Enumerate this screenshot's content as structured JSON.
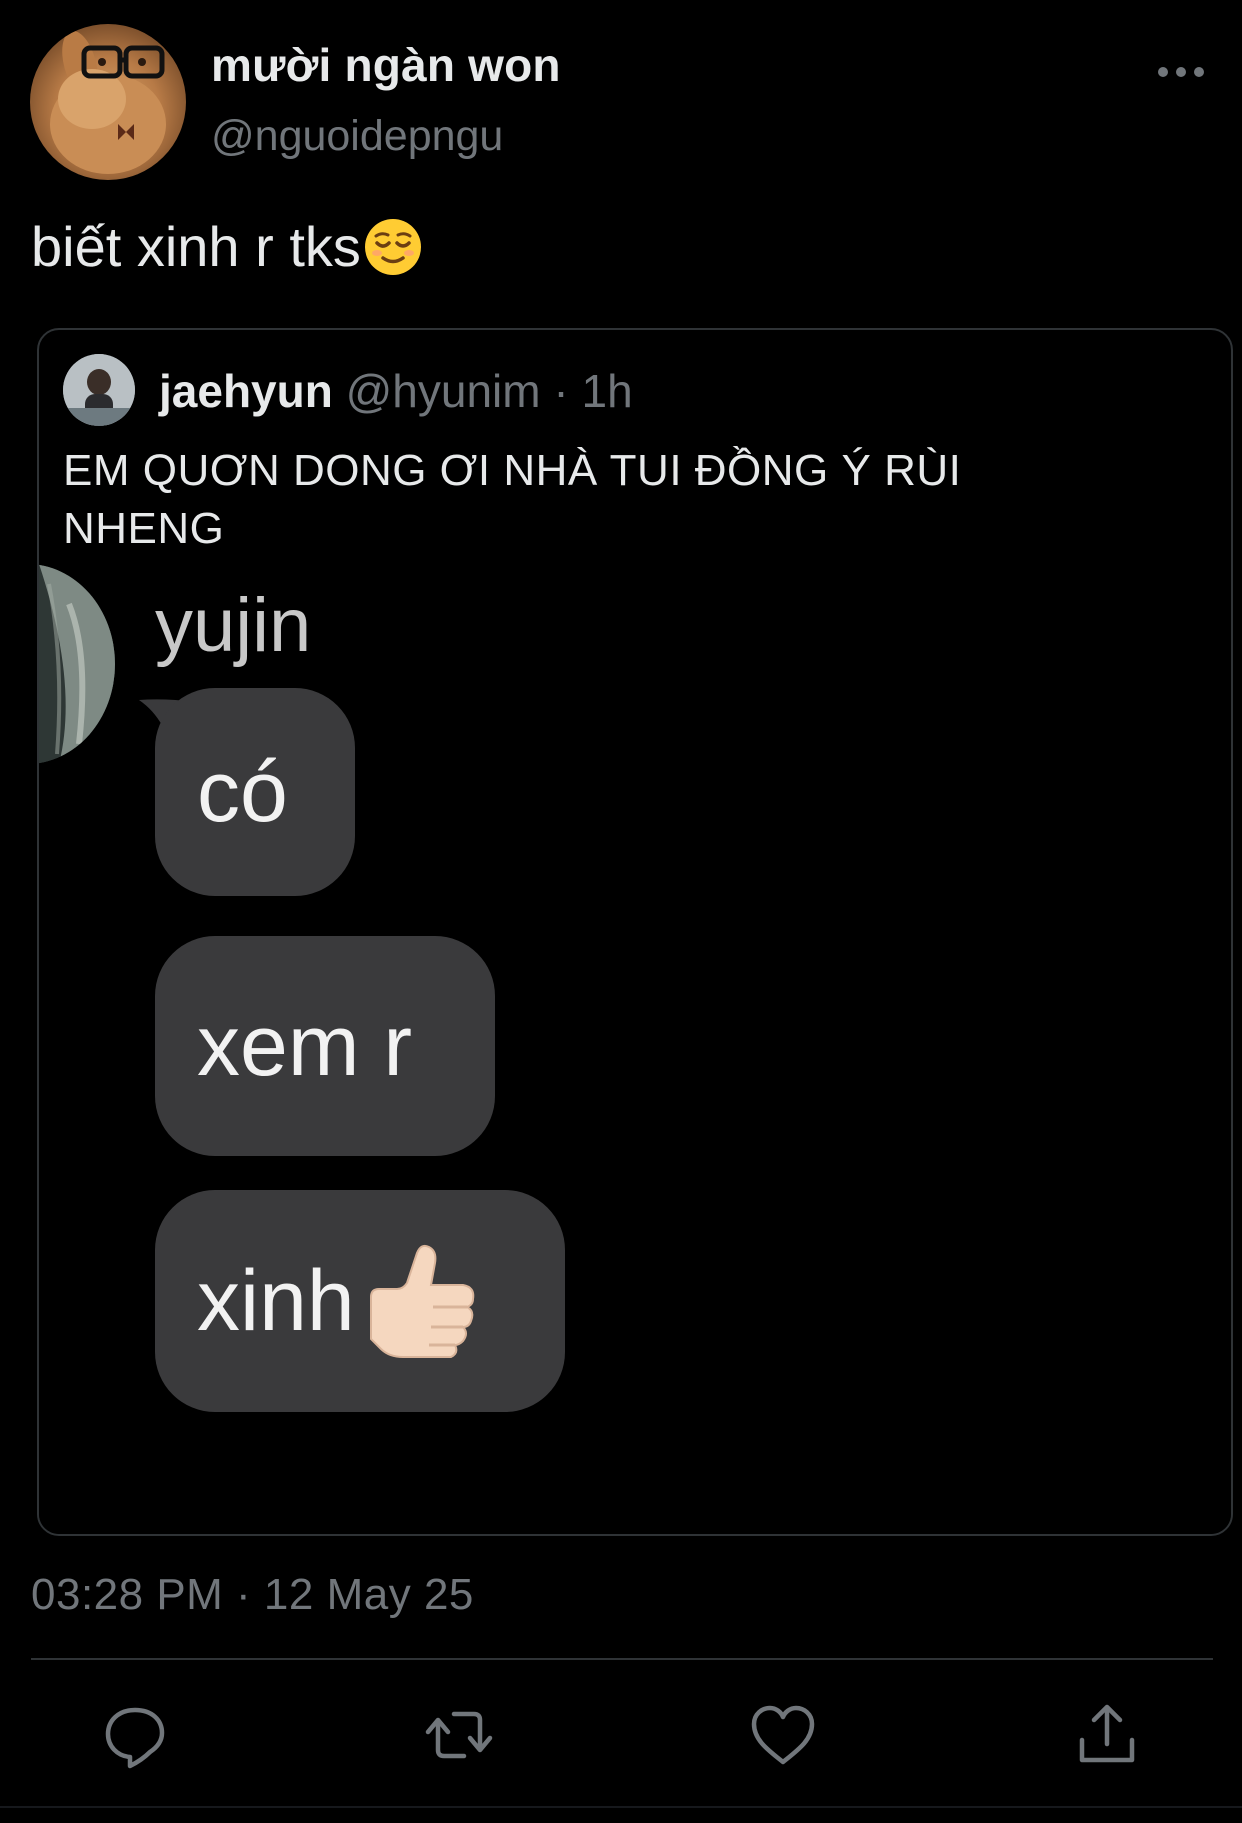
{
  "tweet": {
    "display_name": "mười ngàn won",
    "handle": "@nguoidepngu",
    "text": "biết xinh r tks",
    "text_emoji": "relieved-face-emoji",
    "timestamp": "03:28 PM · 12 May 25"
  },
  "quoted_tweet": {
    "display_name": "jaehyun",
    "handle": "@hyunim",
    "separator": "·",
    "time": "1h",
    "text": "EM QUƠN DONG ƠI NHÀ TUI ĐỒNG Ý RÙI NHENG",
    "image": {
      "sender": "yujin",
      "messages": [
        "có",
        "xem r",
        "xinh"
      ],
      "last_message_emoji": "thumbs-up-emoji"
    }
  },
  "actions": {
    "reply_icon": "reply-icon",
    "retweet_icon": "retweet-icon",
    "like_icon": "heart-icon",
    "share_icon": "share-icon"
  },
  "colors": {
    "background": "#000000",
    "primary_text": "#e7e9ea",
    "secondary_text": "#71767b",
    "border": "#2f3336",
    "bubble": "#3a3a3c"
  }
}
